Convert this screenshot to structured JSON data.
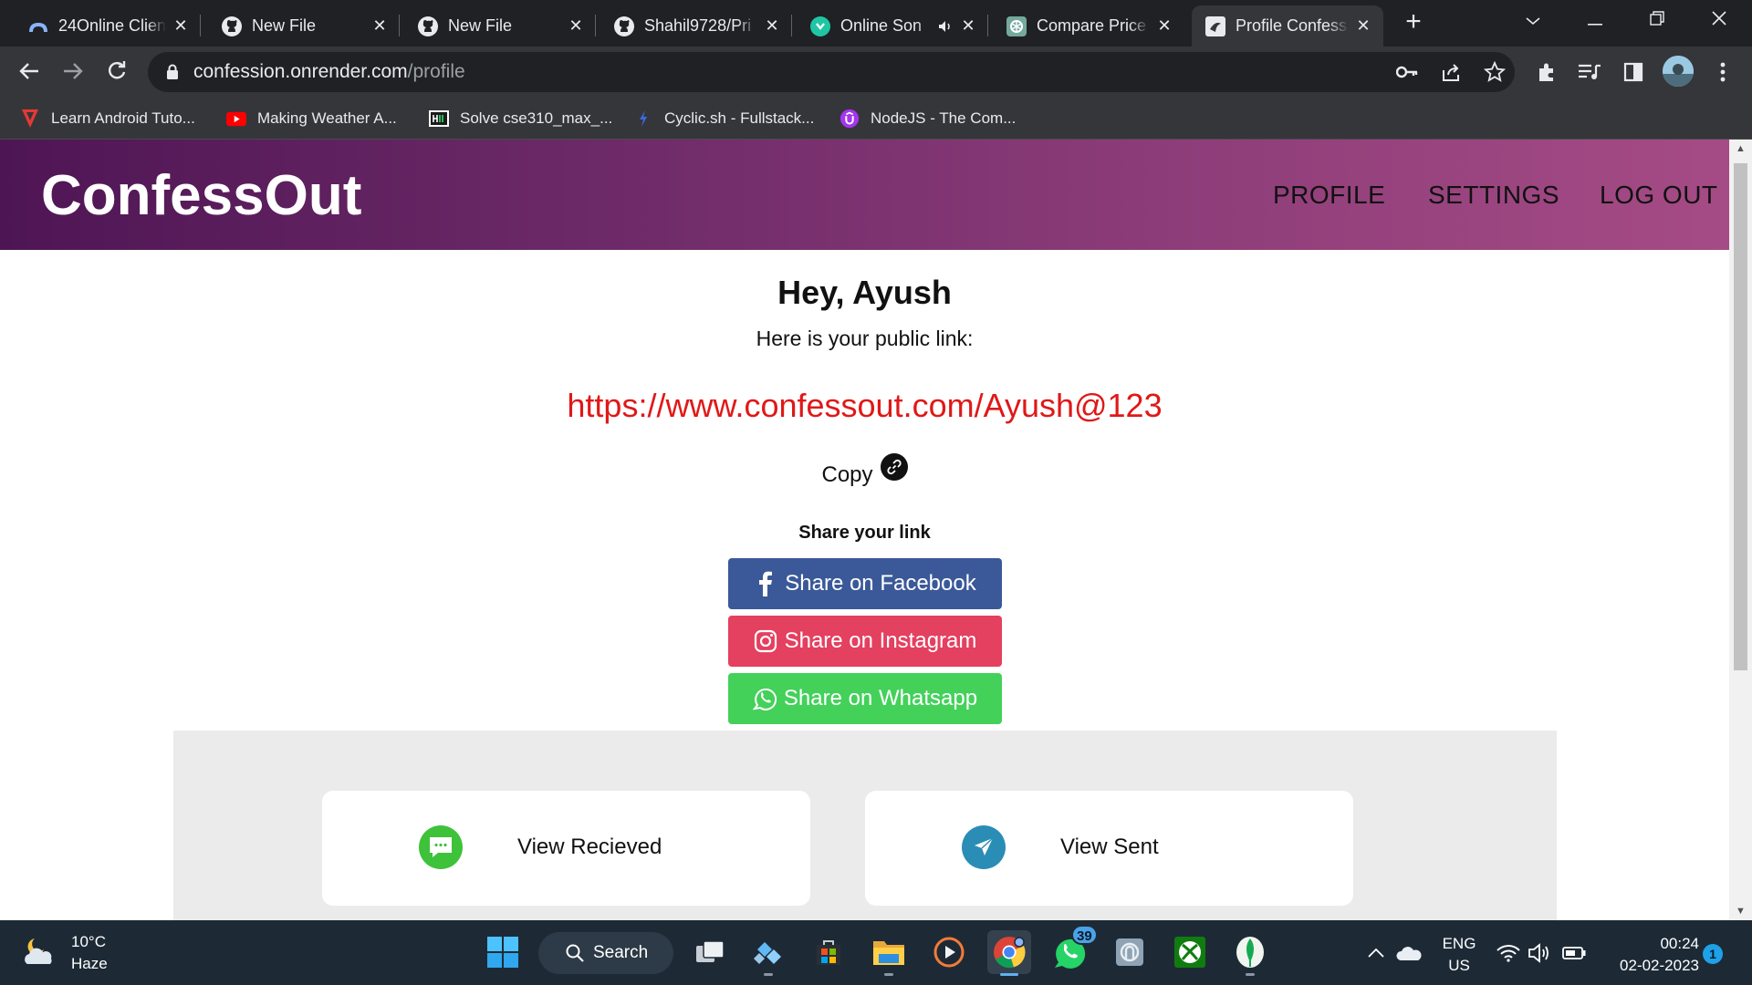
{
  "browser": {
    "tabs": [
      {
        "title": "24Online Client",
        "icon": "cloud-icon"
      },
      {
        "title": "New File",
        "icon": "github-icon"
      },
      {
        "title": "New File",
        "icon": "github-icon"
      },
      {
        "title": "Shahil9728/Pri",
        "icon": "github-icon"
      },
      {
        "title": "Online Son",
        "icon": "songs-site-icon",
        "muted_indicator": "speaker-icon"
      },
      {
        "title": "Compare Price",
        "icon": "openai-icon"
      },
      {
        "title": "Profile Confess",
        "icon": "site-favicon",
        "active": true
      }
    ],
    "url_host": "confession.onrender.com",
    "url_path": "/profile",
    "bookmarks": [
      {
        "label": "Learn Android Tuto...",
        "icon": "red-v-icon"
      },
      {
        "label": "Making Weather A...",
        "icon": "youtube-icon"
      },
      {
        "label": "Solve cse310_max_...",
        "icon": "hackerearth-icon"
      },
      {
        "label": "Cyclic.sh - Fullstack...",
        "icon": "cyclic-icon"
      },
      {
        "label": "NodeJS - The Com...",
        "icon": "udemy-icon"
      }
    ]
  },
  "site": {
    "brand": "ConfessOut",
    "nav": [
      "PROFILE",
      "SETTINGS",
      "LOG OUT"
    ],
    "greeting": "Hey, Ayush",
    "public_link_label": "Here is your public link:",
    "public_link": "https://www.confessout.com/Ayush@123",
    "copy_label": "Copy",
    "share_heading": "Share your link",
    "share_buttons": [
      {
        "label": "Share on Facebook",
        "color": "#3b5998"
      },
      {
        "label": "Share on Instagram",
        "color": "#e4405f"
      },
      {
        "label": "Share on Whatsapp",
        "color": "#43d15a"
      }
    ],
    "cards": [
      {
        "label": "View Recieved",
        "icon": "chat-bubble-icon",
        "color": "#3ec23a"
      },
      {
        "label": "View Sent",
        "icon": "send-icon",
        "color": "#2a8db6"
      }
    ]
  },
  "taskbar": {
    "temperature": "10°C",
    "condition": "Haze",
    "search_label": "Search",
    "whatsapp_badge": "39",
    "language_line1": "ENG",
    "language_line2": "US",
    "time": "00:24",
    "date": "02-02-2023",
    "notification_count": "1"
  }
}
